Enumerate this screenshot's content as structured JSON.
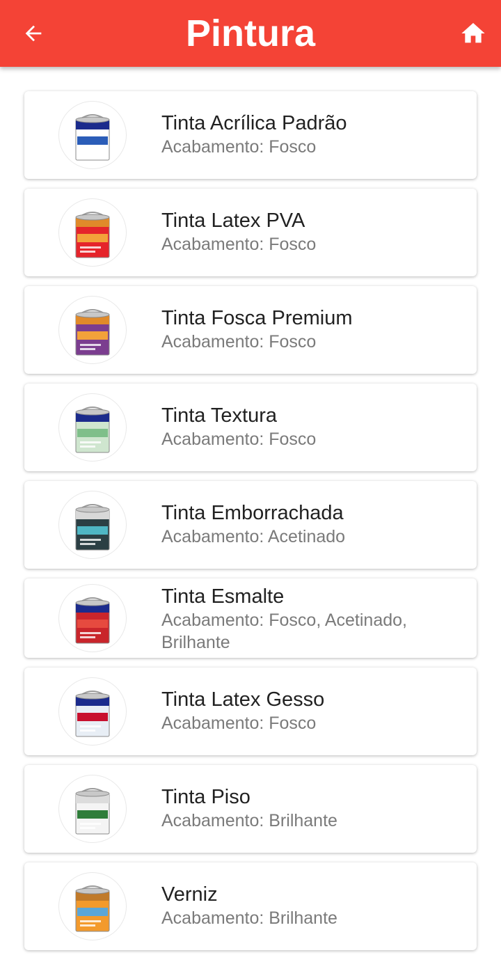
{
  "header": {
    "title": "Pintura",
    "background": "#f44336",
    "back_icon": "arrow-back-icon",
    "home_icon": "home-icon"
  },
  "products": [
    {
      "name": "Tinta Acrílica Padrão",
      "finish": "Acabamento: Fosco",
      "can_top": "#1b2b8c",
      "can_body": "#ffffff",
      "label_color": "#2b5db8"
    },
    {
      "name": "Tinta Latex PVA",
      "finish": "Acabamento: Fosco",
      "can_top": "#e08a2a",
      "can_body": "#e5242b",
      "label_color": "#f3a23a"
    },
    {
      "name": "Tinta Fosca Premium",
      "finish": "Acabamento: Fosco",
      "can_top": "#e08a2a",
      "can_body": "#7b3d8f",
      "label_color": "#f3a23a"
    },
    {
      "name": "Tinta Textura",
      "finish": "Acabamento: Fosco",
      "can_top": "#1b2b8c",
      "can_body": "#cfe6cf",
      "label_color": "#7fbf8a"
    },
    {
      "name": "Tinta Emborrachada",
      "finish": "Acabamento: Acetinado",
      "can_top": "#d8d8d8",
      "can_body": "#2b3f44",
      "label_color": "#4fb6c4"
    },
    {
      "name": "Tinta Esmalte",
      "finish": "Acabamento: Fosco, Acetinado, Brilhante",
      "can_top": "#1b2b8c",
      "can_body": "#c9252b",
      "label_color": "#e64a3f"
    },
    {
      "name": "Tinta Latex Gesso",
      "finish": "Acabamento: Fosco",
      "can_top": "#1b2b8c",
      "can_body": "#e8eef5",
      "label_color": "#c8102e"
    },
    {
      "name": "Tinta Piso",
      "finish": "Acabamento: Brilhante",
      "can_top": "#dcdcdc",
      "can_body": "#f4f4f4",
      "label_color": "#2f7d3a"
    },
    {
      "name": "Verniz",
      "finish": "Acabamento: Brilhante",
      "can_top": "#c07a2a",
      "can_body": "#f39a2c",
      "label_color": "#5aa6d8"
    }
  ]
}
